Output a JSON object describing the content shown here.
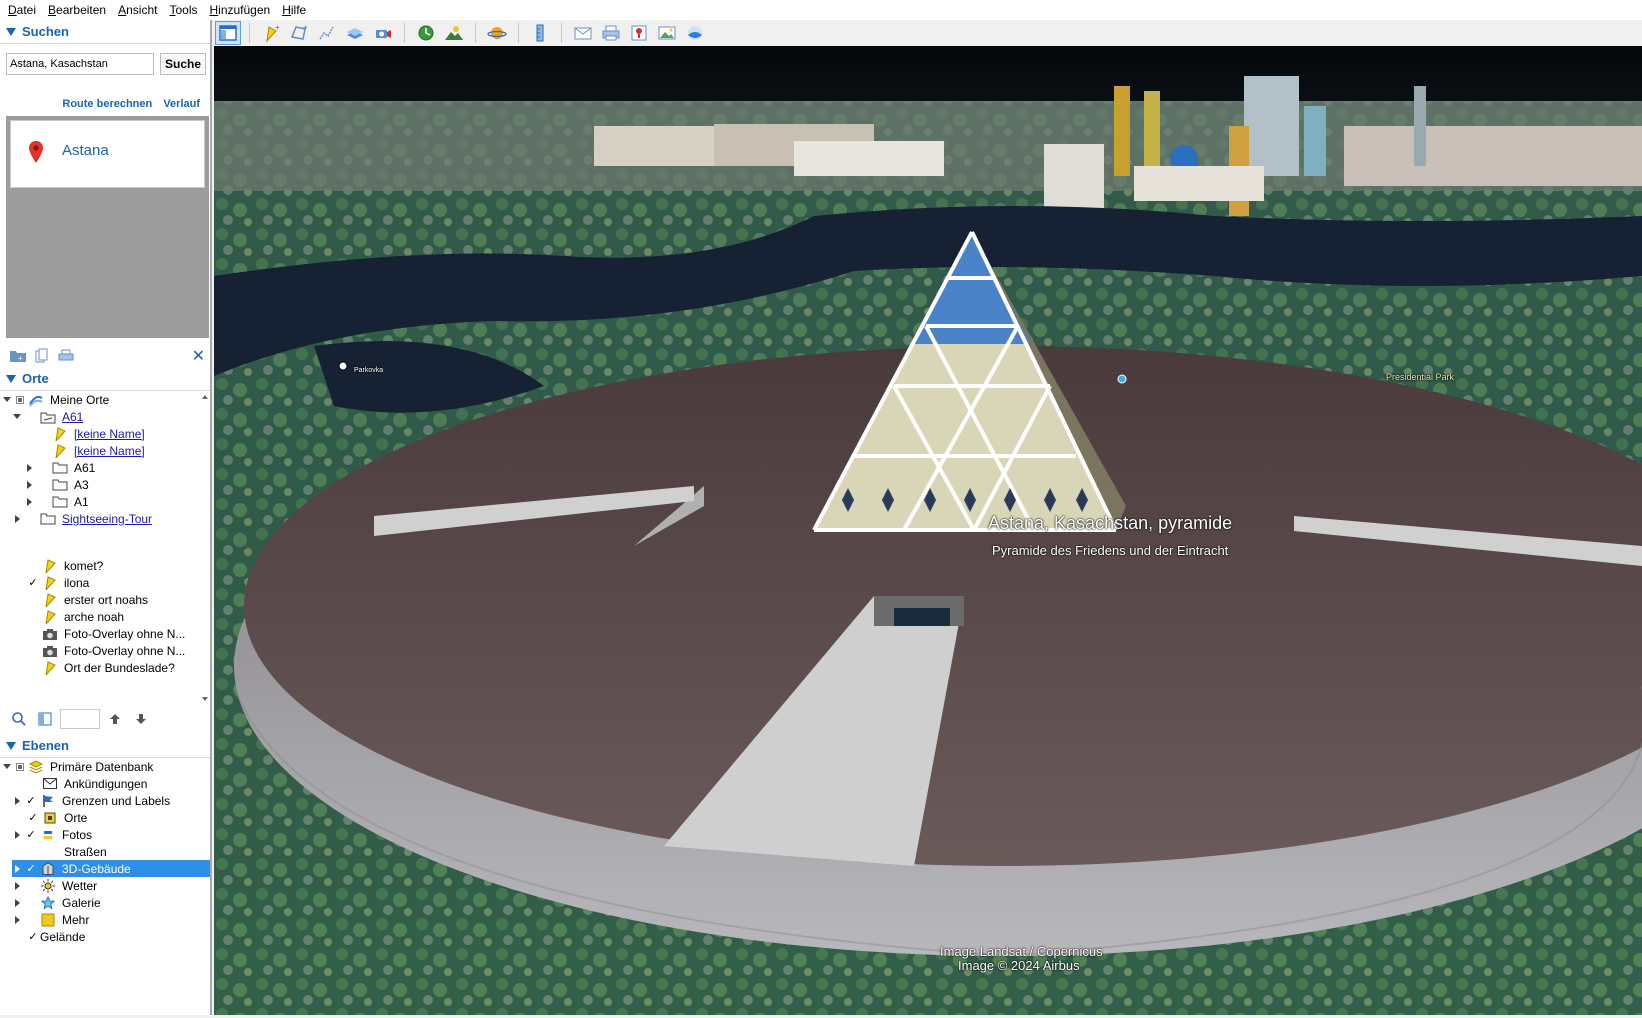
{
  "menu": [
    "Datei",
    "Bearbeiten",
    "Ansicht",
    "Tools",
    "Hinzufügen",
    "Hilfe"
  ],
  "search": {
    "header": "Suchen",
    "query": "Astana, Kasachstan",
    "button": "Suche",
    "route": "Route berechnen",
    "history": "Verlauf",
    "result_name": "Astana"
  },
  "places": {
    "header": "Orte",
    "items": [
      {
        "label": "Meine Orte"
      },
      {
        "label": "A61"
      },
      {
        "label": "[keine Name]"
      },
      {
        "label": "[keine Name]"
      },
      {
        "label": "A61"
      },
      {
        "label": "A3"
      },
      {
        "label": "A1"
      },
      {
        "label": "Sightseeing-Tour"
      },
      {
        "label": "komet?"
      },
      {
        "label": "ilona"
      },
      {
        "label": "erster ort noahs"
      },
      {
        "label": "arche noah"
      },
      {
        "label": "Foto-Overlay ohne N..."
      },
      {
        "label": "Foto-Overlay ohne N..."
      },
      {
        "label": "Ort der Bundeslade?"
      }
    ]
  },
  "layers": {
    "header": "Ebenen",
    "items": [
      {
        "label": "Primäre Datenbank"
      },
      {
        "label": "Ankündigungen"
      },
      {
        "label": "Grenzen und Labels"
      },
      {
        "label": "Orte"
      },
      {
        "label": "Fotos"
      },
      {
        "label": "Straßen"
      },
      {
        "label": "3D-Gebäude"
      },
      {
        "label": "Wetter"
      },
      {
        "label": "Galerie"
      },
      {
        "label": "Mehr"
      },
      {
        "label": "Gelände"
      }
    ]
  },
  "map": {
    "placemark_title": "Astana, Kasachstan, pyramide",
    "placemark_subtitle": "Pyramide des Friedens und der Eintracht",
    "label_parkovka": "Parkovka",
    "label_presidential_park": "Presidential Park",
    "attribution_1": "Image Landsat / Copernicus",
    "attribution_2": "Image © 2024 Airbus"
  },
  "colors": {
    "accent": "#1a64b4",
    "selection": "#2d8fe6",
    "link": "#1a1aaa"
  }
}
